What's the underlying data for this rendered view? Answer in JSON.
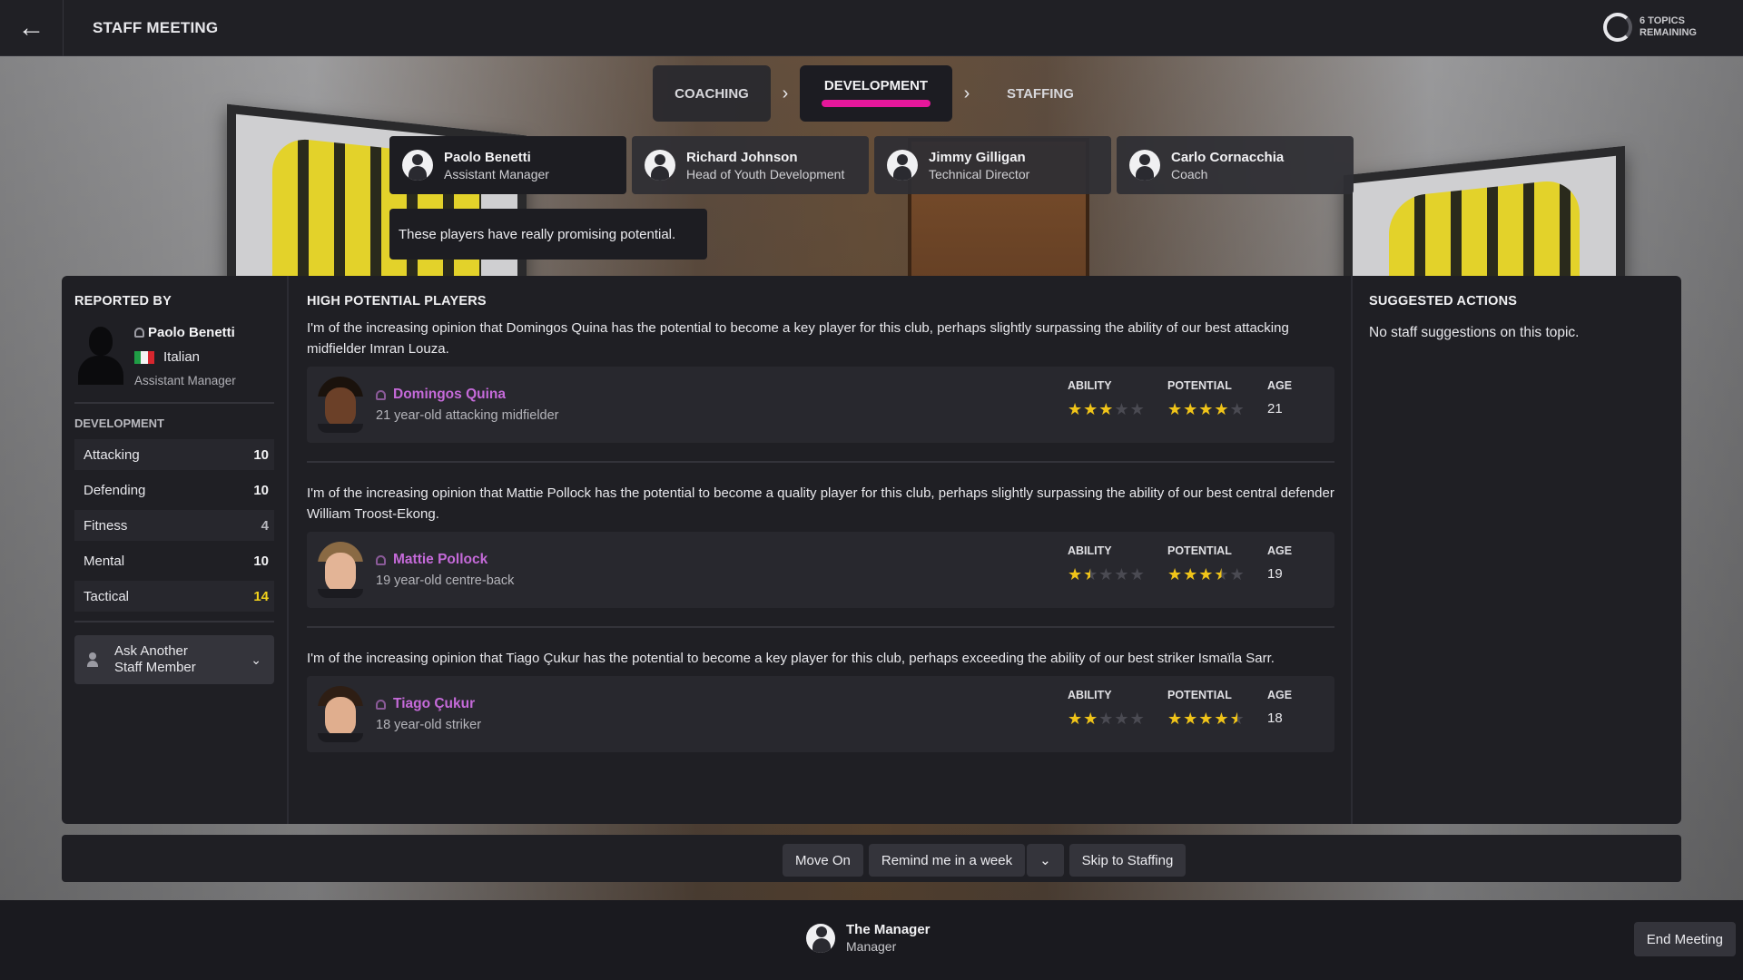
{
  "header": {
    "back_icon": "back-arrow-icon",
    "title": "STAFF MEETING",
    "topics_remaining": "6 TOPICS\nREMAINING",
    "topics_line1": "6 TOPICS",
    "topics_line2": "REMAINING"
  },
  "stages": {
    "coaching": "COACHING",
    "development": "DEVELOPMENT",
    "staffing": "STAFFING",
    "active": "development",
    "accent": "#e5179b"
  },
  "staff": [
    {
      "name": "Paolo Benetti",
      "role": "Assistant Manager",
      "active": true
    },
    {
      "name": "Richard Johnson",
      "role": "Head of Youth Development",
      "active": false
    },
    {
      "name": "Jimmy Gilligan",
      "role": "Technical Director",
      "active": false
    },
    {
      "name": "Carlo Cornacchia",
      "role": "Coach",
      "active": false
    }
  ],
  "speech": "These players have really promising potential.",
  "reporter": {
    "section_title": "REPORTED BY",
    "name": "Paolo Benetti",
    "nationality": "Italian",
    "role": "Assistant Manager",
    "development_title": "DEVELOPMENT",
    "attributes": [
      {
        "label": "Attacking",
        "value": "10"
      },
      {
        "label": "Defending",
        "value": "10"
      },
      {
        "label": "Fitness",
        "value": "4"
      },
      {
        "label": "Mental",
        "value": "10"
      },
      {
        "label": "Tactical",
        "value": "14"
      }
    ],
    "ask_label_line1": "Ask Another",
    "ask_label_line2": "Staff Member"
  },
  "report": {
    "section_title": "HIGH POTENTIAL PLAYERS",
    "labels": {
      "ability": "ABILITY",
      "potential": "POTENTIAL",
      "age": "AGE"
    },
    "players": [
      {
        "text": "I'm of the increasing opinion that Domingos Quina has the potential to become a key player for this club, perhaps slightly surpassing the ability of our best attacking midfielder Imran Louza.",
        "name": "Domingos Quina",
        "desc": "21 year-old attacking midfielder",
        "ability_stars": 3,
        "potential_stars": 4,
        "age": "21"
      },
      {
        "text": "I'm of the increasing opinion that Mattie Pollock has the potential to become a quality player for this club, perhaps slightly surpassing the ability of our best central defender William Troost-Ekong.",
        "name": "Mattie Pollock",
        "desc": "19 year-old centre-back",
        "ability_stars": 1.5,
        "potential_stars": 3.5,
        "age": "19"
      },
      {
        "text": "I'm of the increasing opinion that Tiago Çukur has the potential to become a key player for this club, perhaps exceeding the ability of our best striker Ismaïla Sarr.",
        "name": "Tiago Çukur",
        "desc": "18 year-old striker",
        "ability_stars": 2,
        "potential_stars": 4.5,
        "age": "18"
      }
    ]
  },
  "suggested": {
    "section_title": "SUGGESTED ACTIONS",
    "text": "No staff suggestions on this topic."
  },
  "actions": {
    "move_on": "Move On",
    "remind": "Remind me in a week",
    "skip": "Skip to Staffing"
  },
  "footer": {
    "manager_name": "The Manager",
    "manager_role": "Manager",
    "end_meeting": "End Meeting"
  },
  "colors": {
    "star": "#f0c419",
    "player_link": "#c56ad9",
    "highlight_value": "#f2d21b"
  }
}
